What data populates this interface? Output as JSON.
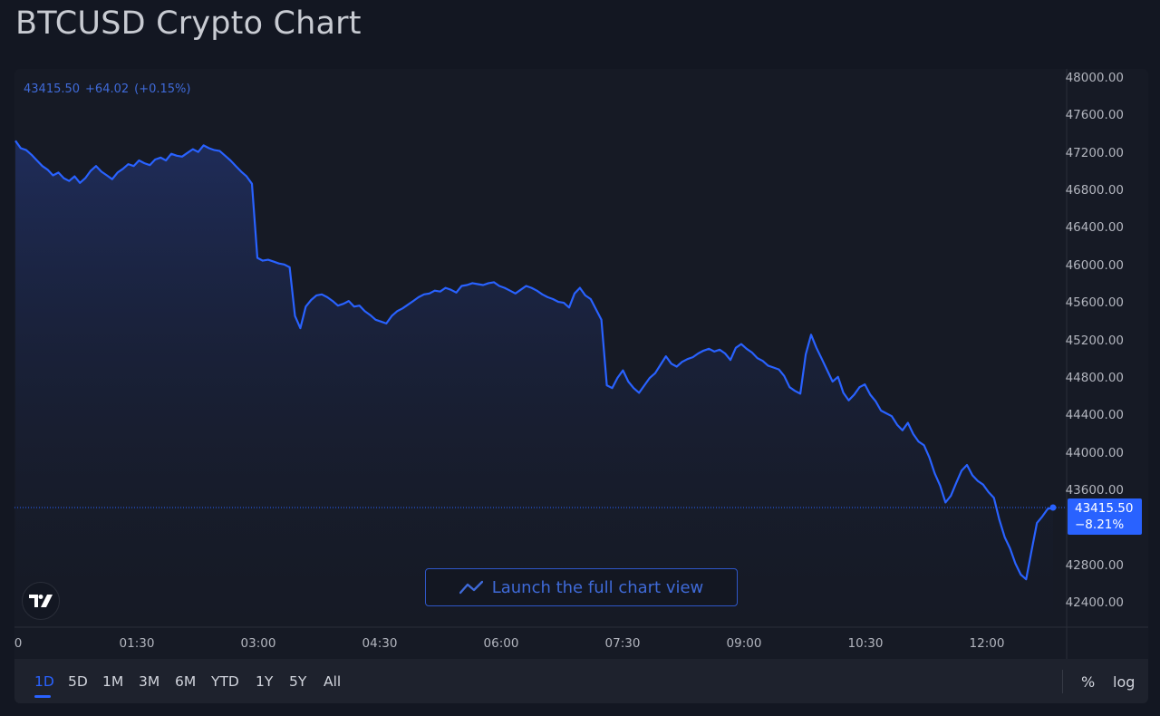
{
  "page": {
    "title": "BTCUSD Crypto Chart"
  },
  "legend": {
    "price": "43415.50",
    "change": "+64.02",
    "change_pct": "(+0.15%)"
  },
  "price_tag": {
    "price": "43415.50",
    "change_pct": "−8.21%"
  },
  "launch_button": {
    "label": "Launch the full chart view",
    "icon": "line-chart-icon"
  },
  "logo": {
    "icon": "tradingview-logo-icon"
  },
  "toolbar": {
    "ranges": [
      {
        "label": "1D",
        "active": true
      },
      {
        "label": "5D",
        "active": false
      },
      {
        "label": "1M",
        "active": false
      },
      {
        "label": "3M",
        "active": false
      },
      {
        "label": "6M",
        "active": false
      },
      {
        "label": "YTD",
        "active": false
      },
      {
        "label": "1Y",
        "active": false
      },
      {
        "label": "5Y",
        "active": false
      },
      {
        "label": "All",
        "active": false
      }
    ],
    "percent_label": "%",
    "log_label": "log"
  },
  "colors": {
    "line": "#2962ff",
    "accent": "#2962ff",
    "background": "#131722",
    "area_top": "#1f2d5c",
    "area_bottom": "#161a25"
  },
  "chart_data": {
    "type": "area",
    "title": "BTCUSD",
    "xlabel": "",
    "ylabel": "",
    "ylim": [
      42400,
      48000
    ],
    "y_ticks": [
      "48000.00",
      "47600.00",
      "47200.00",
      "46800.00",
      "46400.00",
      "46000.00",
      "45600.00",
      "45200.00",
      "44800.00",
      "44400.00",
      "44000.00",
      "43600.00",
      "42800.00",
      "42400.00"
    ],
    "x_ticks": [
      {
        "label": "0",
        "minute": 0
      },
      {
        "label": "01:30",
        "minute": 90
      },
      {
        "label": "03:00",
        "minute": 180
      },
      {
        "label": "04:30",
        "minute": 270
      },
      {
        "label": "06:00",
        "minute": 360
      },
      {
        "label": "07:30",
        "minute": 450
      },
      {
        "label": "09:00",
        "minute": 540
      },
      {
        "label": "10:30",
        "minute": 630
      },
      {
        "label": "12:00",
        "minute": 720
      }
    ],
    "x_range_minutes": [
      0,
      850
    ],
    "last_price": 43415.5,
    "interval_minutes": 5,
    "series": [
      {
        "name": "BTCUSD",
        "values": [
          47330,
          47250,
          47230,
          47180,
          47120,
          47060,
          47020,
          46960,
          46990,
          46930,
          46900,
          46950,
          46880,
          46930,
          47010,
          47060,
          47000,
          46960,
          46920,
          46990,
          47030,
          47080,
          47060,
          47120,
          47090,
          47070,
          47130,
          47150,
          47120,
          47190,
          47170,
          47160,
          47200,
          47240,
          47210,
          47280,
          47250,
          47230,
          47220,
          47170,
          47120,
          47060,
          47000,
          46950,
          46870,
          46080,
          46050,
          46060,
          46040,
          46020,
          46010,
          45980,
          45460,
          45330,
          45560,
          45630,
          45680,
          45690,
          45660,
          45620,
          45570,
          45590,
          45620,
          45560,
          45570,
          45510,
          45470,
          45420,
          45400,
          45380,
          45460,
          45510,
          45540,
          45580,
          45620,
          45660,
          45690,
          45700,
          45730,
          45720,
          45760,
          45740,
          45710,
          45780,
          45790,
          45810,
          45800,
          45790,
          45810,
          45820,
          45780,
          45760,
          45730,
          45700,
          45740,
          45780,
          45760,
          45730,
          45690,
          45660,
          45640,
          45610,
          45600,
          45550,
          45700,
          45760,
          45680,
          45640,
          45530,
          45420,
          44720,
          44690,
          44800,
          44880,
          44760,
          44690,
          44640,
          44720,
          44800,
          44850,
          44940,
          45030,
          44950,
          44920,
          44970,
          45000,
          45020,
          45060,
          45090,
          45110,
          45080,
          45100,
          45060,
          44990,
          45120,
          45160,
          45110,
          45070,
          45010,
          44980,
          44930,
          44910,
          44890,
          44820,
          44700,
          44660,
          44630,
          45050,
          45260,
          45120,
          45000,
          44880,
          44760,
          44810,
          44640,
          44560,
          44620,
          44700,
          44730,
          44620,
          44550,
          44450,
          44420,
          44390,
          44300,
          44240,
          44320,
          44200,
          44120,
          44080,
          43950,
          43780,
          43650,
          43470,
          43540,
          43680,
          43810,
          43870,
          43760,
          43700,
          43660,
          43580,
          43520,
          43290,
          43100,
          42980,
          42820,
          42700,
          42650,
          42950,
          43250,
          43320,
          43400,
          43415.5
        ]
      }
    ]
  }
}
